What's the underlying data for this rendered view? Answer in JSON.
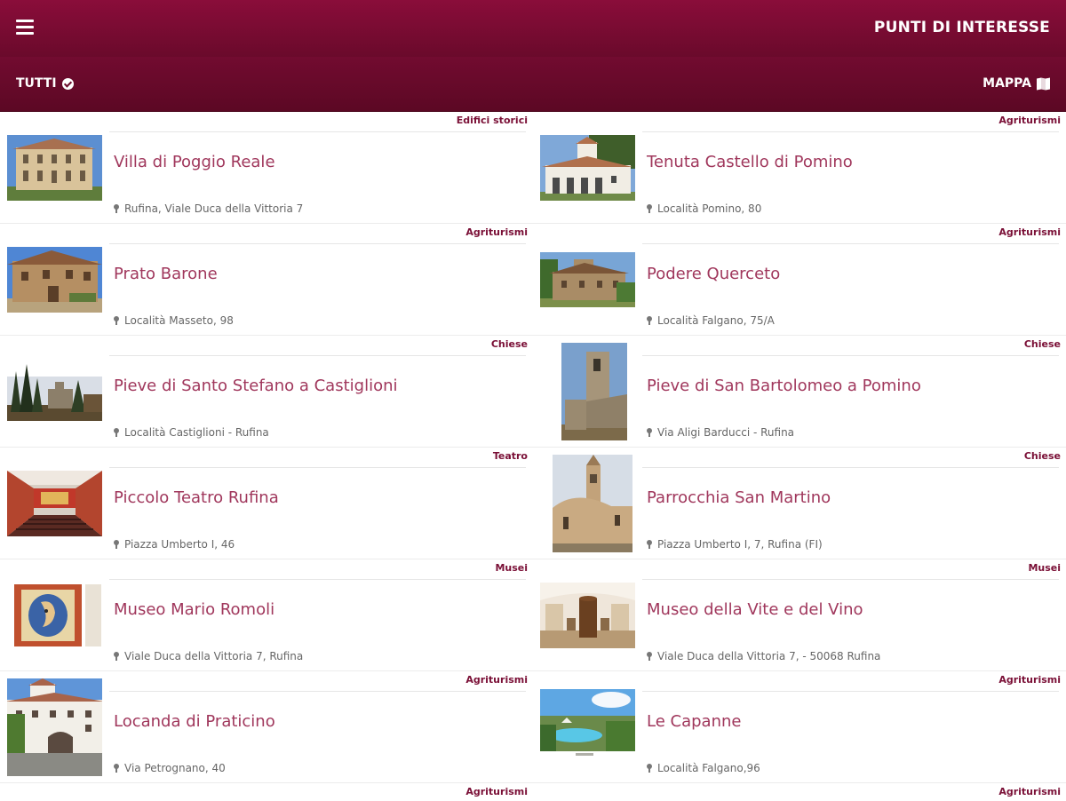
{
  "header": {
    "title": "PUNTI DI INTERESSE"
  },
  "filterbar": {
    "filter_label": "TUTTI",
    "map_label": "MAPPA"
  },
  "items": [
    {
      "category": "Edifici storici",
      "name": "Villa di Poggio Reale",
      "address": "Rufina, Viale Duca della Vittoria 7"
    },
    {
      "category": "Agriturismi",
      "name": "Tenuta Castello di Pomino",
      "address": "Località Pomino, 80"
    },
    {
      "category": "Agriturismi",
      "name": "Prato Barone",
      "address": "Località Masseto, 98"
    },
    {
      "category": "Agriturismi",
      "name": "Podere Querceto",
      "address": "Località Falgano, 75/A"
    },
    {
      "category": "Chiese",
      "name": "Pieve di Santo Stefano a Castiglioni",
      "address": "Località Castiglioni - Rufina"
    },
    {
      "category": "Chiese",
      "name": "Pieve di San Bartolomeo a Pomino",
      "address": "Via Aligi Barducci - Rufina"
    },
    {
      "category": "Teatro",
      "name": "Piccolo Teatro Rufina",
      "address": "Piazza Umberto I, 46"
    },
    {
      "category": "Chiese",
      "name": "Parrocchia San Martino",
      "address": "Piazza Umberto I, 7, Rufina (FI)"
    },
    {
      "category": "Musei",
      "name": "Museo Mario Romoli",
      "address": "Viale Duca della Vittoria 7, Rufina"
    },
    {
      "category": "Musei",
      "name": "Museo della Vite e del Vino",
      "address": "Viale Duca della Vittoria 7, - 50068 Rufina"
    },
    {
      "category": "Agriturismi",
      "name": "Locanda di Praticino",
      "address": "Via Petrognano, 40"
    },
    {
      "category": "Agriturismi",
      "name": "Le Capanne",
      "address": "Località Falgano,96"
    }
  ],
  "peek": [
    {
      "category": "Agriturismi"
    },
    {
      "category": "Agriturismi"
    }
  ]
}
